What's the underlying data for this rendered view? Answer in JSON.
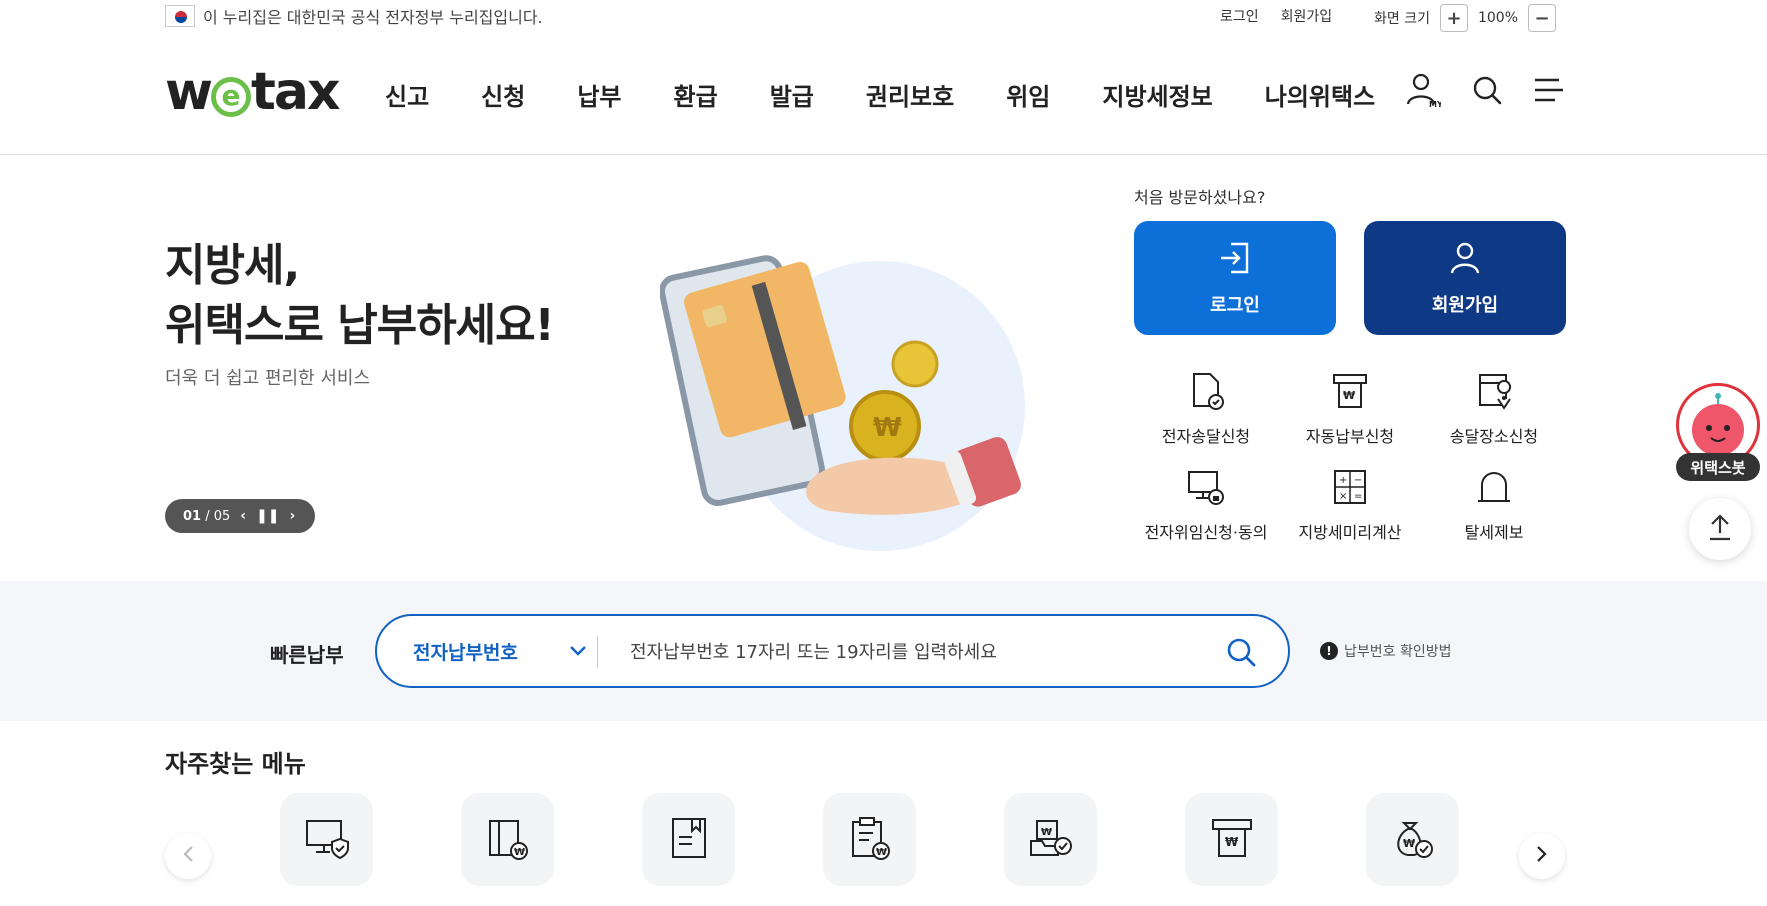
{
  "gov_banner": {
    "text": "이 누리집은 대한민국 공식 전자정부 누리집입니다."
  },
  "util": {
    "login": "로그인",
    "join": "회원가입",
    "zoom_label": "화면 크기",
    "zoom_plus": "+",
    "zoom_value": "100%",
    "zoom_minus": "−"
  },
  "logo": {
    "before": "w",
    "e": "e",
    "after": "tax"
  },
  "nav": [
    "신고",
    "신청",
    "납부",
    "환급",
    "발급",
    "권리보호",
    "위임",
    "지방세정보",
    "나의위택스"
  ],
  "header_icons": [
    "my-page-icon",
    "search-icon",
    "menu-icon"
  ],
  "hero": {
    "title_line1": "지방세,",
    "title_line2": "위택스로 납부하세요!",
    "subtitle": "더욱 더 쉽고 편리한 서비스",
    "pager_current": "01",
    "pager_total": "/ 05"
  },
  "visit": {
    "question": "처음 방문하셨나요?",
    "login_label": "로그인",
    "join_label": "회원가입"
  },
  "services": [
    {
      "label": "전자송달신청",
      "icon": "document-check-icon"
    },
    {
      "label": "자동납부신청",
      "icon": "atm-won-icon"
    },
    {
      "label": "송달장소신청",
      "icon": "location-doc-icon"
    },
    {
      "label": "전자위임신청·동의",
      "icon": "monitor-lock-icon"
    },
    {
      "label": "지방세미리계산",
      "icon": "calculator-icon"
    },
    {
      "label": "탈세제보",
      "icon": "siren-icon"
    }
  ],
  "quick_pay": {
    "label": "빠른납부",
    "select_value": "전자납부번호",
    "placeholder": "전자납부번호 17자리 또는 19자리를 입력하세요",
    "help": "납부번호 확인방법"
  },
  "frequent": {
    "title": "자주찾는 메뉴",
    "icons": [
      "monitor-shield-icon",
      "box-won-icon",
      "bookmark-doc-icon",
      "clipboard-won-icon",
      "tray-won-check-icon",
      "atm-won-icon",
      "money-bag-check-icon"
    ]
  },
  "chatbot": {
    "label": "위택스봇"
  },
  "colors": {
    "primary": "#0d6fd8",
    "navy": "#0e3a85",
    "quick_border": "#1262c4",
    "logo_green": "#6cc04a",
    "bot_red": "#e0323b"
  }
}
